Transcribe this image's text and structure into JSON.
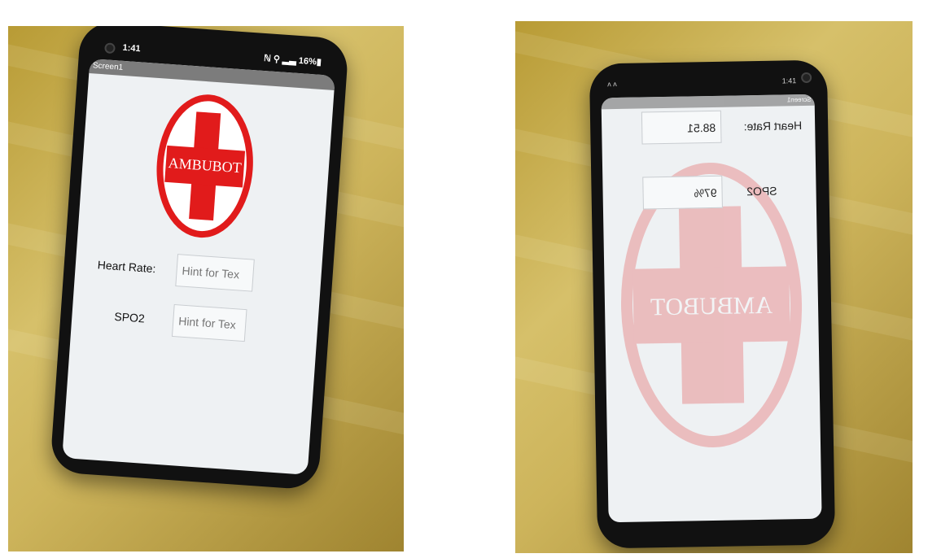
{
  "left_phone": {
    "status_time": "1:41",
    "status_icons": "ℕ ⚲ ▂▃ 16%▮",
    "app_title": "Screen1",
    "logo_text": "AMBUBOT",
    "heart_rate_label": "Heart Rate:",
    "heart_rate_placeholder": "Hint for Tex",
    "spo2_label": "SPO2",
    "spo2_placeholder": "Hint for Tex"
  },
  "right_phone": {
    "status_left": "ᴧ ᴧ",
    "status_right": "1:41",
    "app_title": "Screen1",
    "heart_rate_label": "Heart Rate:",
    "heart_rate_value": "88.51",
    "spo2_label": "SPO2",
    "spo2_value": "97%"
  },
  "colors": {
    "accent_red": "#e11b1b",
    "screen_bg": "#eef1f3",
    "phone_body": "#111111",
    "photo_bg": "#cdb45b"
  },
  "icons": {
    "wifi": "wifi-icon",
    "battery": "battery-icon",
    "camera": "camera-icon",
    "medical_cross": "medical-cross-icon"
  }
}
